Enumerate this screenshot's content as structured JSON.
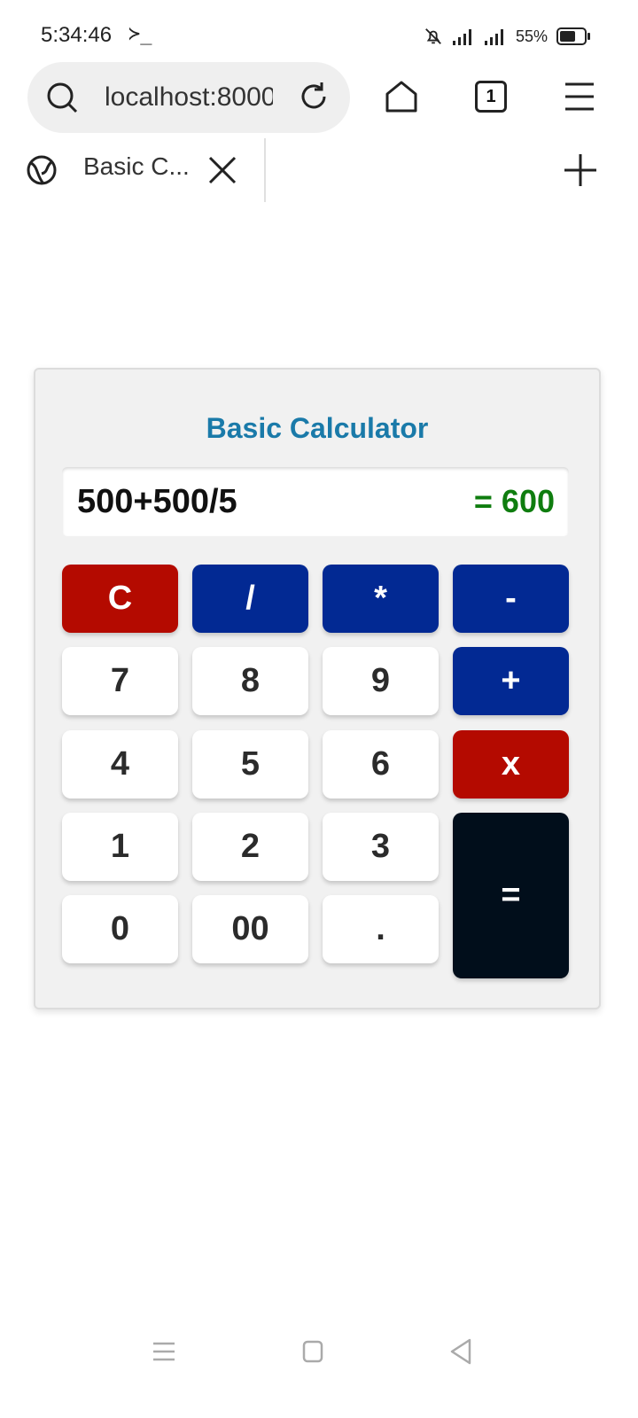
{
  "status_bar": {
    "time": "5:34:46",
    "terminal_glyph": "≻_",
    "battery_percent": "55%",
    "icons": [
      "bell-off-icon",
      "signal-icon",
      "signal-icon",
      "battery-icon"
    ]
  },
  "browser": {
    "url": "localhost:8000",
    "tab_count": "1",
    "tab_title": "Basic C...",
    "icons": [
      "search-icon",
      "reload-icon",
      "home-icon",
      "tabs-icon",
      "menu-icon",
      "globe-icon",
      "close-icon",
      "plus-icon"
    ]
  },
  "calculator": {
    "title": "Basic Calculator",
    "expression": "500+500/5",
    "result": "= 600",
    "buttons": {
      "clear": "C",
      "divide": "/",
      "multiply": "*",
      "minus": "-",
      "plus": "+",
      "backspace": "x",
      "equals": "=",
      "d7": "7",
      "d8": "8",
      "d9": "9",
      "d4": "4",
      "d5": "5",
      "d6": "6",
      "d1": "1",
      "d2": "2",
      "d3": "3",
      "d0": "0",
      "d00": "00",
      "dot": "."
    },
    "colors": {
      "title": "#1a7aa9",
      "result": "#0f7d0f",
      "operator": "#022993",
      "danger": "#b40a00",
      "equals": "#010e1b"
    }
  },
  "nav_bar": {
    "icons": [
      "recents-icon",
      "home-nav-icon",
      "back-icon"
    ]
  }
}
